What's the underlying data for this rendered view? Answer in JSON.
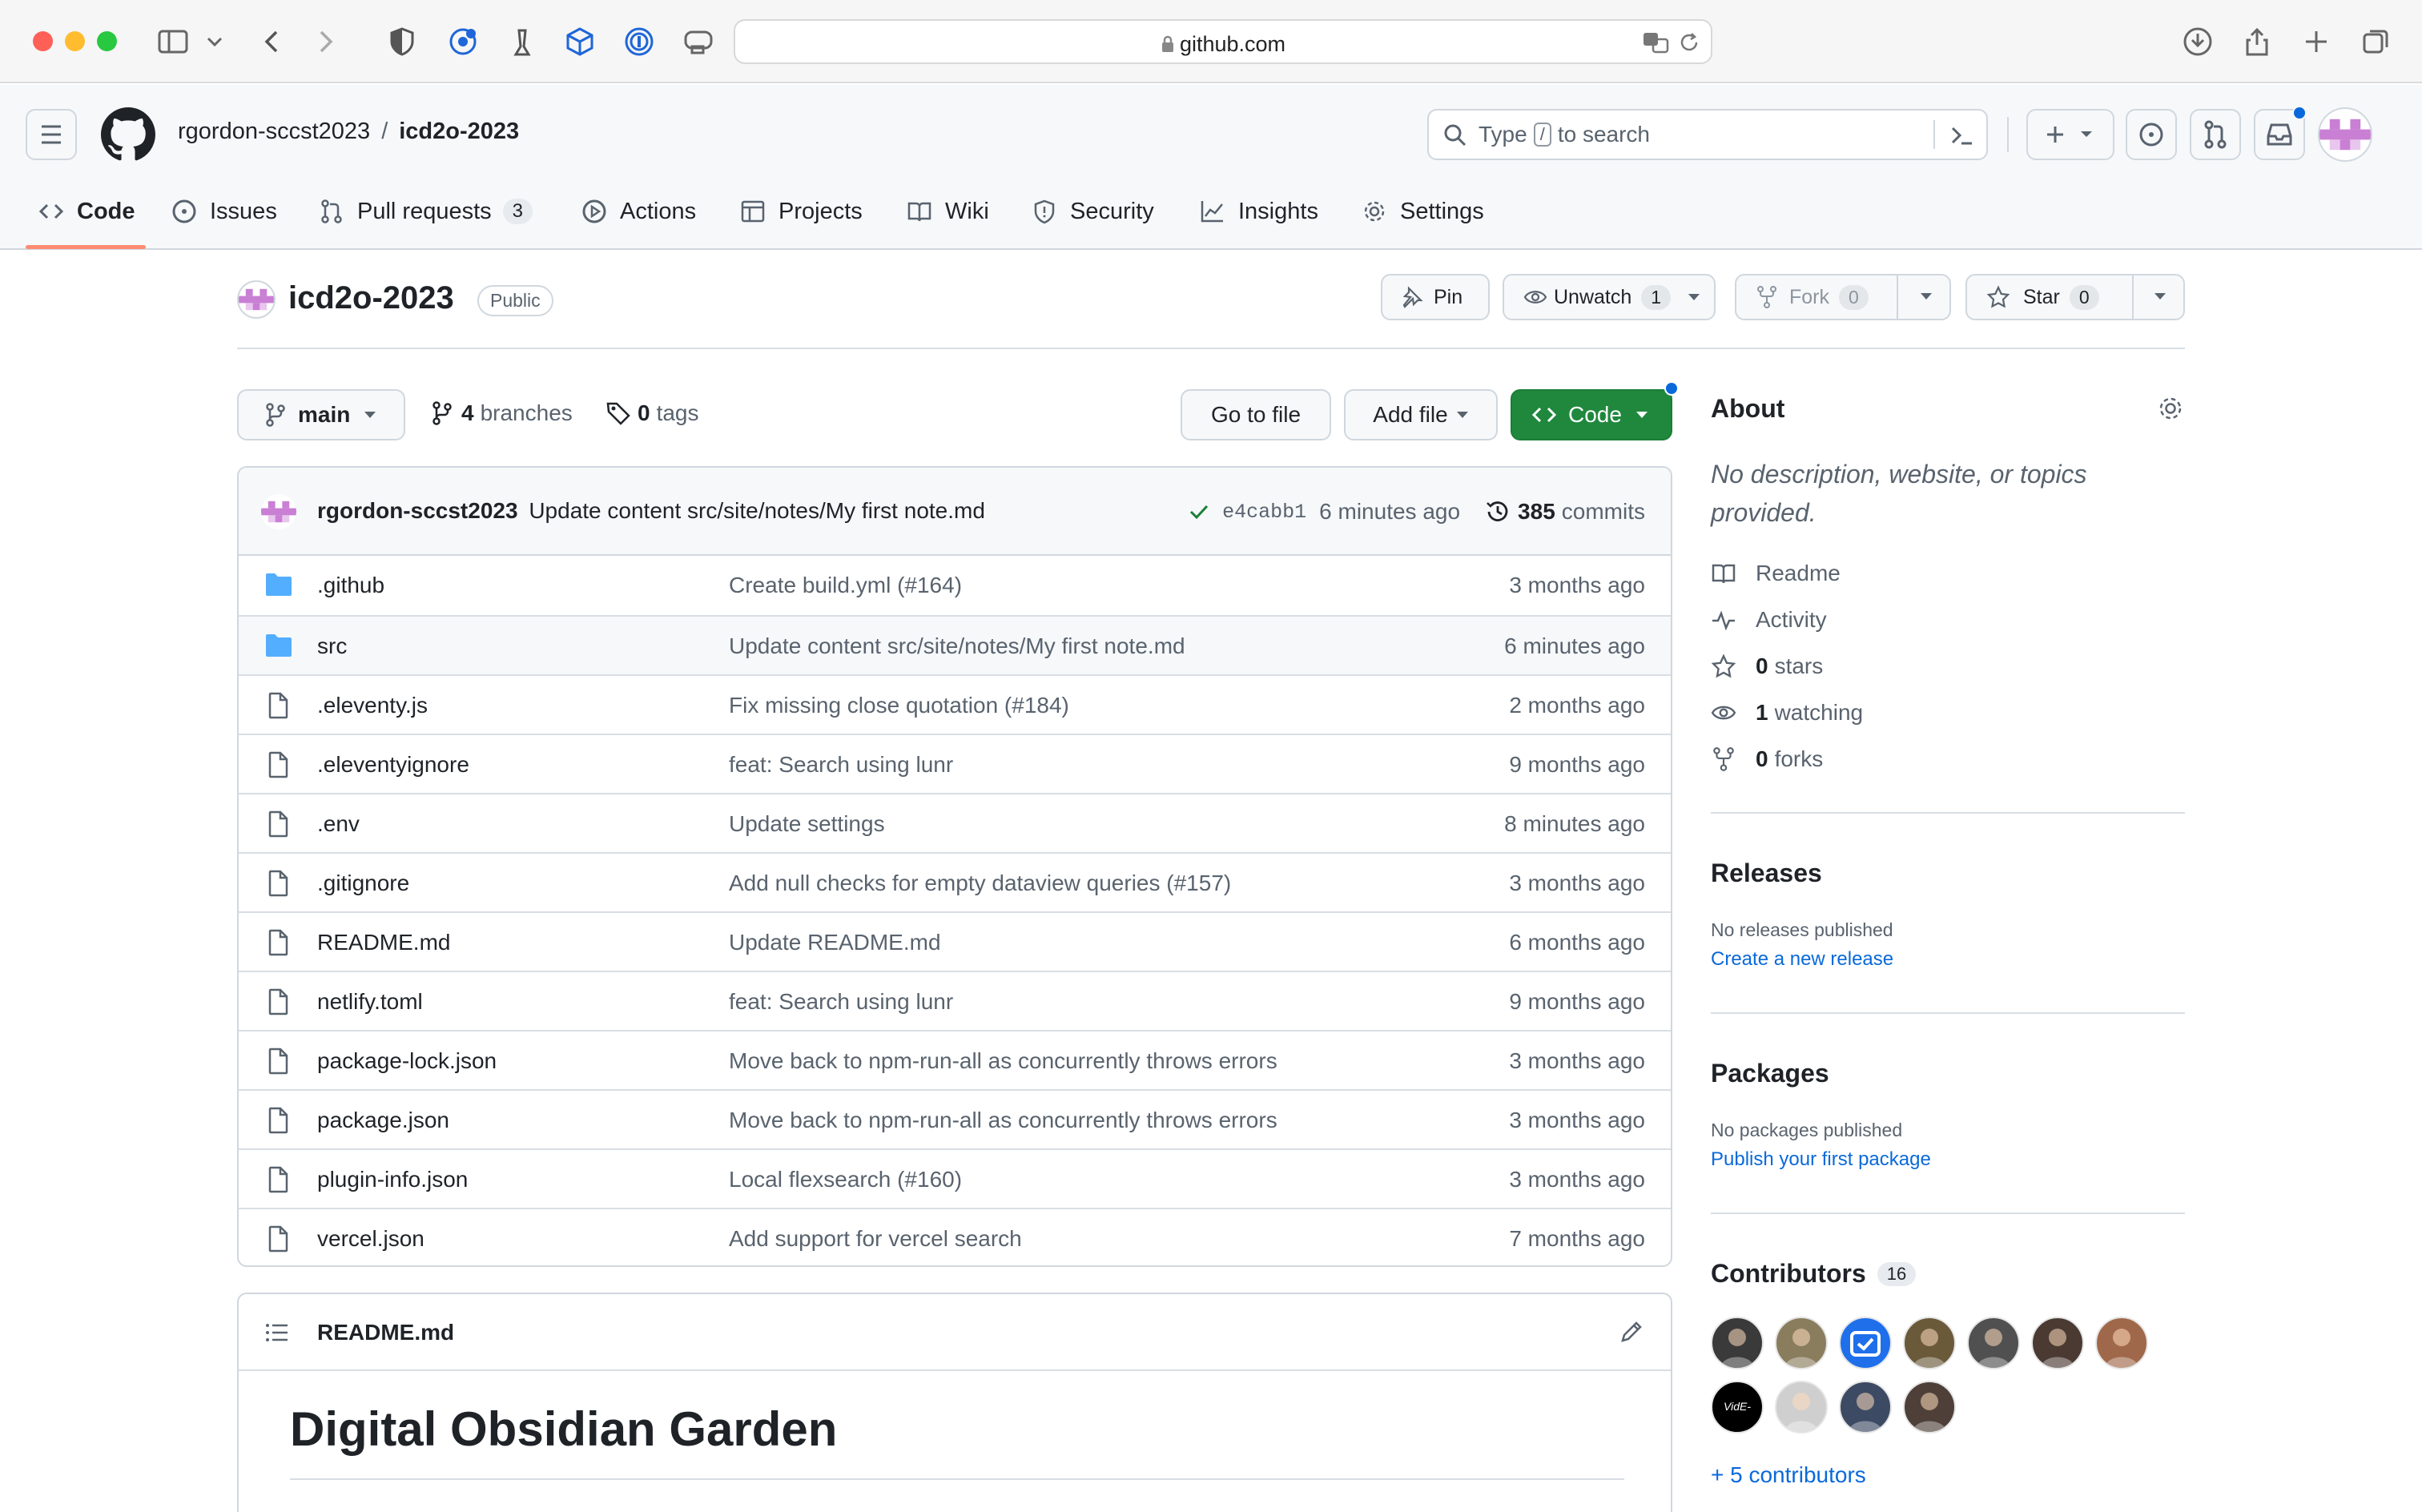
{
  "browser": {
    "url": "github.com"
  },
  "header": {
    "owner": "rgordon-sccst2023",
    "separator": "/",
    "repo": "icd2o-2023",
    "search_prefix": "Type",
    "search_key": "/",
    "search_suffix": "to search"
  },
  "nav": {
    "tabs": [
      {
        "label": "Code",
        "icon": "code-icon"
      },
      {
        "label": "Issues",
        "icon": "issue-icon"
      },
      {
        "label": "Pull requests",
        "icon": "pull-request-icon",
        "count": "3"
      },
      {
        "label": "Actions",
        "icon": "play-icon"
      },
      {
        "label": "Projects",
        "icon": "table-icon"
      },
      {
        "label": "Wiki",
        "icon": "book-icon"
      },
      {
        "label": "Security",
        "icon": "shield-icon"
      },
      {
        "label": "Insights",
        "icon": "graph-icon"
      },
      {
        "label": "Settings",
        "icon": "gear-icon"
      }
    ],
    "active": "Code"
  },
  "repo_title": {
    "name": "icd2o-2023",
    "visibility": "Public",
    "pin": "Pin",
    "unwatch": "Unwatch",
    "watch_count": "1",
    "fork": "Fork",
    "fork_count": "0",
    "star": "Star",
    "star_count": "0"
  },
  "toolbar": {
    "branch": "main",
    "branches_count": "4",
    "branches_label": "branches",
    "tags_count": "0",
    "tags_label": "tags",
    "go_to_file": "Go to file",
    "add_file": "Add file",
    "code": "Code"
  },
  "latest_commit": {
    "author": "rgordon-sccst2023",
    "message": "Update content src/site/notes/My first note.md",
    "sha": "e4cabb1",
    "age": "6 minutes ago",
    "commits_count": "385",
    "commits_label": "commits"
  },
  "files": [
    {
      "type": "dir",
      "name": ".github",
      "message": "Create build.yml (#164)",
      "age": "3 months ago"
    },
    {
      "type": "dir",
      "name": "src",
      "message": "Update content src/site/notes/My first note.md",
      "age": "6 minutes ago"
    },
    {
      "type": "file",
      "name": ".eleventy.js",
      "message": "Fix missing close quotation (#184)",
      "age": "2 months ago"
    },
    {
      "type": "file",
      "name": ".eleventyignore",
      "message": "feat: Search using lunr",
      "age": "9 months ago"
    },
    {
      "type": "file",
      "name": ".env",
      "message": "Update settings",
      "age": "8 minutes ago"
    },
    {
      "type": "file",
      "name": ".gitignore",
      "message": "Add null checks for empty dataview queries (#157)",
      "age": "3 months ago"
    },
    {
      "type": "file",
      "name": "README.md",
      "message": "Update README.md",
      "age": "6 months ago"
    },
    {
      "type": "file",
      "name": "netlify.toml",
      "message": "feat: Search using lunr",
      "age": "9 months ago"
    },
    {
      "type": "file",
      "name": "package-lock.json",
      "message": "Move back to npm-run-all as concurrently throws errors",
      "age": "3 months ago"
    },
    {
      "type": "file",
      "name": "package.json",
      "message": "Move back to npm-run-all as concurrently throws errors",
      "age": "3 months ago"
    },
    {
      "type": "file",
      "name": "plugin-info.json",
      "message": "Local flexsearch (#160)",
      "age": "3 months ago"
    },
    {
      "type": "file",
      "name": "vercel.json",
      "message": "Add support for vercel search",
      "age": "7 months ago"
    }
  ],
  "readme": {
    "filename": "README.md",
    "heading": "Digital Obsidian Garden"
  },
  "about": {
    "title": "About",
    "description": "No description, website, or topics provided.",
    "items": [
      {
        "icon": "book-icon",
        "count": "",
        "label": "Readme"
      },
      {
        "icon": "pulse-icon",
        "count": "",
        "label": "Activity"
      },
      {
        "icon": "star-icon",
        "count": "0",
        "label": "stars"
      },
      {
        "icon": "eye-icon",
        "count": "1",
        "label": "watching"
      },
      {
        "icon": "fork-icon",
        "count": "0",
        "label": "forks"
      }
    ]
  },
  "releases": {
    "title": "Releases",
    "empty": "No releases published",
    "link": "Create a new release"
  },
  "packages": {
    "title": "Packages",
    "empty": "No packages published",
    "link": "Publish your first package"
  },
  "contributors": {
    "title": "Contributors",
    "count": "16",
    "more": "+ 5 contributors",
    "avatar_badge": "VidE-"
  },
  "colors": {
    "accent": "#0969da",
    "primary_green": "#1f883d",
    "active_tab": "#fd8c73",
    "folder": "#54aeff"
  }
}
